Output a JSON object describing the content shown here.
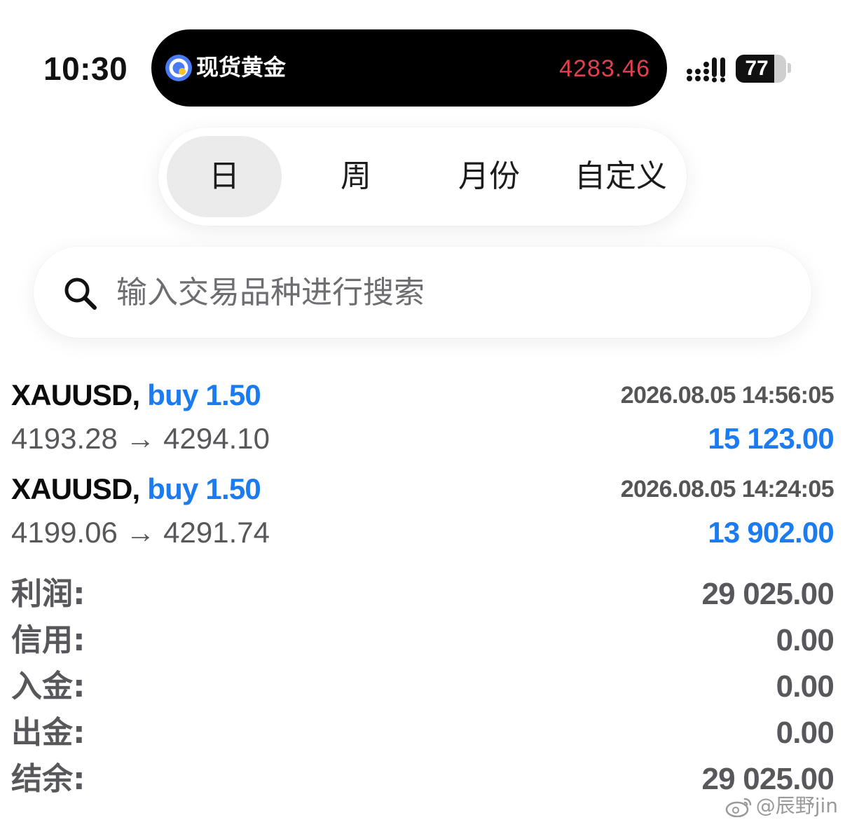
{
  "status_bar": {
    "time": "10:30",
    "battery": "77",
    "battery_level": 0.77
  },
  "live_activity": {
    "title": "现货黄金",
    "price": "4283.46",
    "price_color": "#e0404d"
  },
  "period_tabs": [
    {
      "label": "日",
      "active": true
    },
    {
      "label": "周",
      "active": false
    },
    {
      "label": "月份",
      "active": false
    },
    {
      "label": "自定义",
      "active": false
    }
  ],
  "search": {
    "placeholder": "输入交易品种进行搜索",
    "value": ""
  },
  "deals": [
    {
      "symbol": "XAUUSD,",
      "side": "buy 1.50",
      "time": "2026.08.05 14:56:05",
      "prices": "4193.28 → 4294.10",
      "profit": "15 123.00"
    },
    {
      "symbol": "XAUUSD,",
      "side": "buy 1.50",
      "time": "2026.08.05 14:24:05",
      "prices": "4199.06 → 4291.74",
      "profit": "13 902.00"
    }
  ],
  "summary": [
    {
      "label": "利润:",
      "value": "29 025.00"
    },
    {
      "label": "信用:",
      "value": "0.00"
    },
    {
      "label": "入金:",
      "value": "0.00"
    },
    {
      "label": "出金:",
      "value": "0.00"
    },
    {
      "label": "结余:",
      "value": "29 025.00"
    }
  ],
  "watermark": {
    "text": "@辰野jin",
    "icon": "weibo-icon"
  },
  "colors": {
    "accent_blue": "#1a7cf0",
    "text_gray": "#58585c",
    "active_tab_bg": "#ebebeb"
  }
}
